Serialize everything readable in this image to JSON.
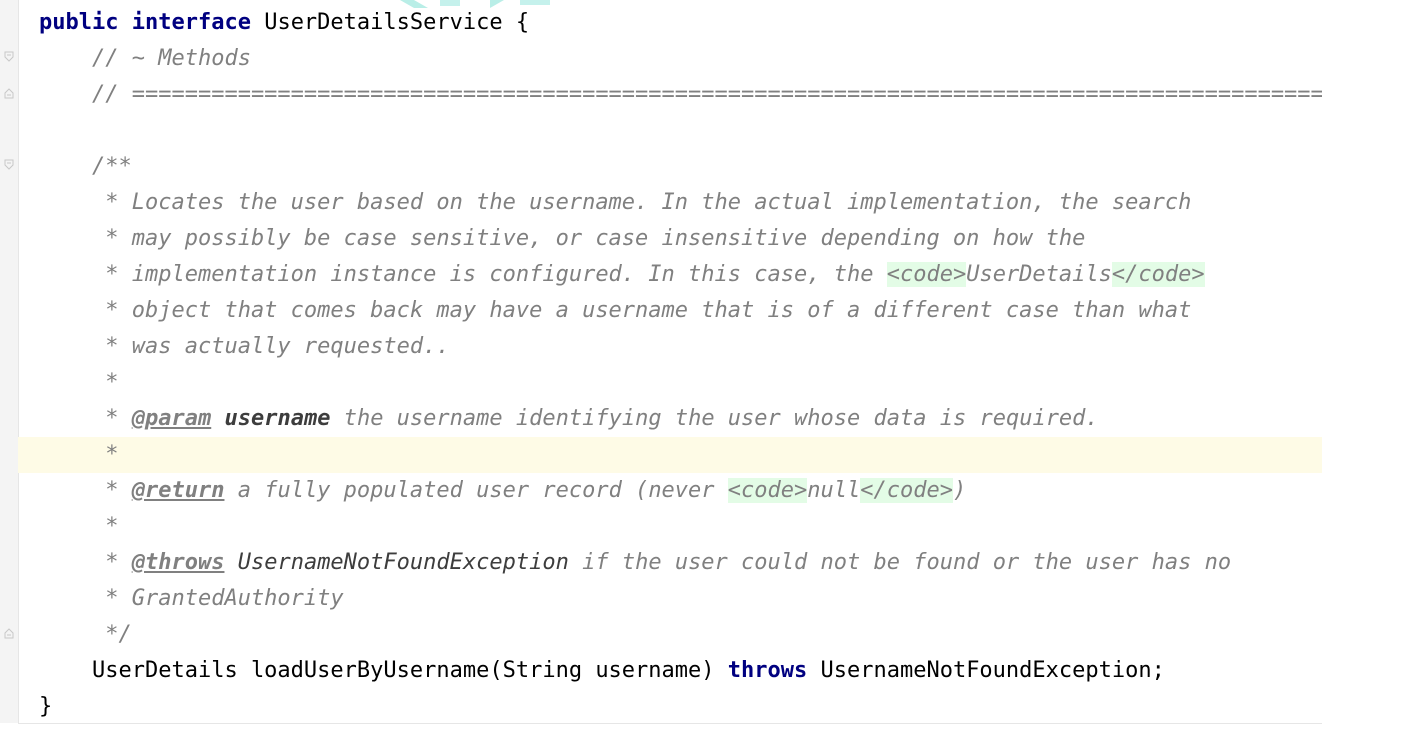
{
  "code": {
    "line1": {
      "kw_public": "public",
      "kw_interface": "interface",
      "rest": " UserDetailsService {"
    },
    "line2": "// ~ Methods",
    "line3": "// ==========================================================================================",
    "line5": "/**",
    "line6": " * Locates the user based on the username. In the actual implementation, the search",
    "line7": " * may possibly be case sensitive, or case insensitive depending on how the",
    "line8": {
      "pre": " * implementation instance is configured. In this case, the ",
      "code_open": "<code>",
      "value": "UserDetails",
      "code_close": "</code>"
    },
    "line9": " * object that comes back may have a username that is of a different case than what",
    "line10": " * was actually requested..",
    "line11": " *",
    "line12": {
      "star": " * ",
      "tag": "@param",
      "space": " ",
      "param": "username",
      "desc": " the username identifying the user whose data is required."
    },
    "line13": " *",
    "line14": {
      "star": " * ",
      "tag": "@return",
      "desc": " a fully populated user record (never ",
      "code_open": "<code>",
      "value": "null",
      "code_close": "</code>",
      "end": ")"
    },
    "line15": " *",
    "line16": {
      "star": " * ",
      "tag": "@throws",
      "space": " ",
      "exception": "UsernameNotFoundException",
      "desc": " if the user could not be found or the user has no"
    },
    "line17": " * GrantedAuthority",
    "line18": " */",
    "line19": {
      "pre": "UserDetails loadUserByUsername(String username) ",
      "kw_throws": "throws",
      "post": " UsernameNotFoundException;"
    },
    "line20": "}"
  },
  "colors": {
    "keyword": "#000080",
    "comment": "#808080",
    "html_tag_bg": "#e3fce6",
    "current_line_bg": "#fefbe6",
    "watermark": "#7fe0d4"
  },
  "icons": [
    "fold-start-icon",
    "fold-end-icon"
  ]
}
